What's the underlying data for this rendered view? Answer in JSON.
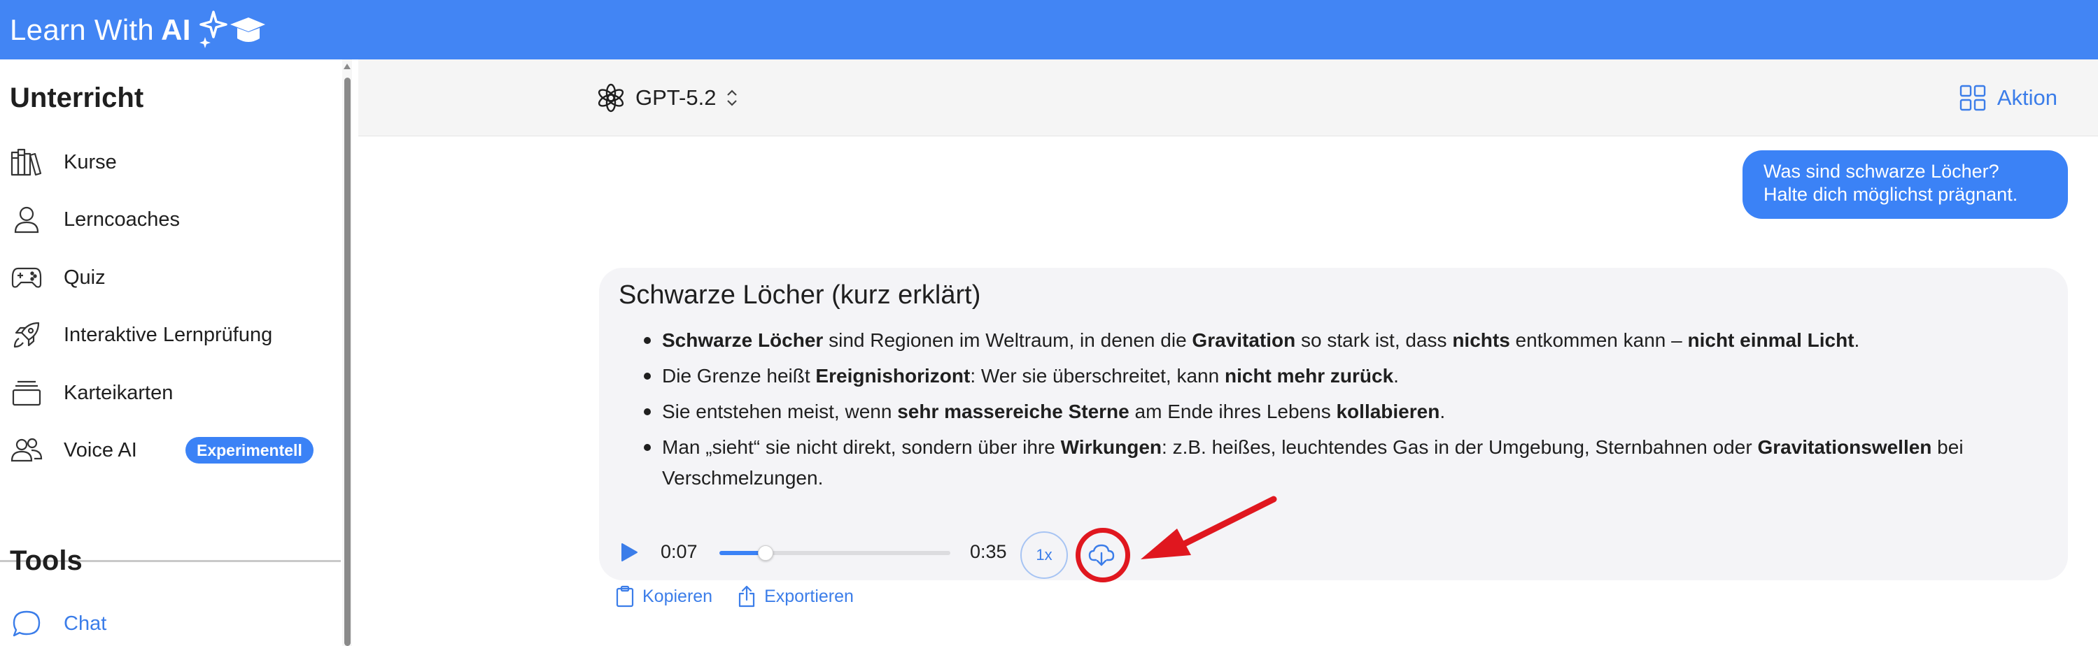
{
  "app": {
    "brand_text": "Learn With",
    "brand_ai": "AI",
    "brand_icon": "sparkles-graduation-cap-icon"
  },
  "colors": {
    "header_bg": "#4285f4",
    "accent": "#3b82f6",
    "highlight_ring": "#e0171f"
  },
  "sidebar": {
    "section_lessons": "Unterricht",
    "items": [
      {
        "label": "Kurse",
        "icon": "books-icon"
      },
      {
        "label": "Lerncoaches",
        "icon": "person-icon"
      },
      {
        "label": "Quiz",
        "icon": "gamepad-icon"
      },
      {
        "label": "Interaktive Lernprüfung",
        "icon": "rocket-icon"
      },
      {
        "label": "Karteikarten",
        "icon": "cards-stack-icon"
      },
      {
        "label": "Voice AI",
        "icon": "users-icon",
        "badge": "Experimentell"
      }
    ],
    "section_tools": "Tools",
    "tools": [
      {
        "label": "Chat",
        "icon": "chat-bubble-icon",
        "active": true
      }
    ]
  },
  "chat_header": {
    "model_name": "GPT-5.2",
    "model_icon": "openai-logo-icon",
    "action_label": "Aktion",
    "action_icon": "grid-icon"
  },
  "user_message": {
    "line1": "Was sind schwarze Löcher?",
    "line2": "Halte dich möglichst prägnant."
  },
  "answer": {
    "title": "Schwarze Löcher (kurz erklärt)",
    "bullets": [
      [
        {
          "t": "Schwarze Löcher",
          "b": true
        },
        {
          "t": " sind Regionen im Weltraum, in denen die "
        },
        {
          "t": "Gravitation",
          "b": true
        },
        {
          "t": " so stark ist, dass "
        },
        {
          "t": "nichts",
          "b": true
        },
        {
          "t": " entkommen kann – "
        },
        {
          "t": "nicht einmal Licht",
          "b": true
        },
        {
          "t": "."
        }
      ],
      [
        {
          "t": "Die Grenze heißt "
        },
        {
          "t": "Ereignishorizont",
          "b": true
        },
        {
          "t": ": Wer sie überschreitet, kann "
        },
        {
          "t": "nicht mehr zurück",
          "b": true
        },
        {
          "t": "."
        }
      ],
      [
        {
          "t": "Sie entstehen meist, wenn "
        },
        {
          "t": "sehr massereiche Sterne",
          "b": true
        },
        {
          "t": " am Ende ihres Lebens "
        },
        {
          "t": "kollabieren",
          "b": true
        },
        {
          "t": "."
        }
      ],
      [
        {
          "t": "Man „sieht“ sie nicht direkt, sondern über ihre "
        },
        {
          "t": "Wirkungen",
          "b": true
        },
        {
          "t": ": z.B. heißes, leuchtendes Gas in der Umgebung, Sternbahnen oder "
        },
        {
          "t": "Gravitationswellen",
          "b": true
        },
        {
          "t": " bei Verschmelzungen."
        }
      ]
    ]
  },
  "audio": {
    "current_time": "0:07",
    "duration": "0:35",
    "progress": 0.2,
    "speed_label": "1x",
    "download_icon": "cloud-download-icon"
  },
  "message_actions": {
    "copy_label": "Kopieren",
    "export_label": "Exportieren"
  }
}
